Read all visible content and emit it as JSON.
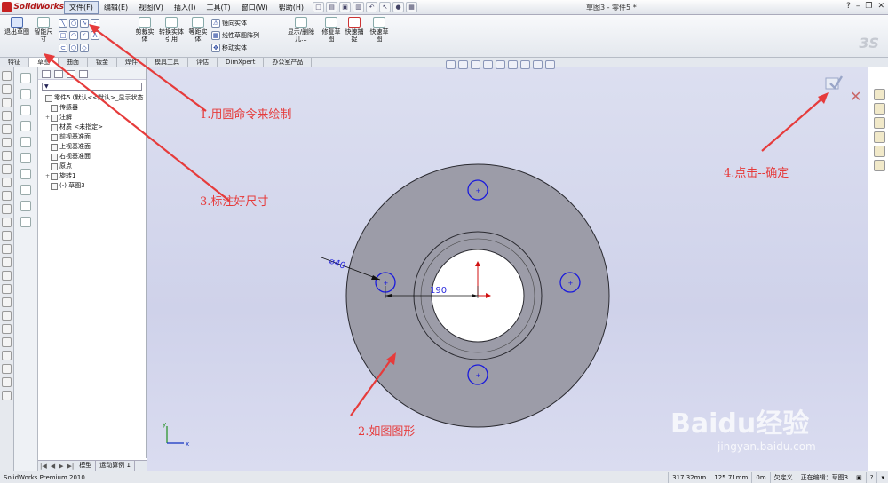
{
  "app": {
    "name": "SolidWorks",
    "doc_title": "草图3 - 零件5 *"
  },
  "menu": [
    "文件(F)",
    "编辑(E)",
    "视图(V)",
    "插入(I)",
    "工具(T)",
    "窗口(W)",
    "帮助(H)"
  ],
  "ribbon": {
    "exit_sketch": "退出草图",
    "smart_dim": "智能尺寸",
    "trim": "剪裁实体",
    "convert": "转换实体引用",
    "offset": "等距实体",
    "mirror": "镜向实体",
    "linear_pattern": "线性草图阵列",
    "move": "移动实体",
    "display_delete": "显示/删除几...",
    "repair": "修复草图",
    "quick_snap": "快速捕捉",
    "rapid_sketch": "快速草图"
  },
  "tabs": [
    "特征",
    "草图",
    "曲面",
    "钣金",
    "焊件",
    "模具工具",
    "评估",
    "DimXpert",
    "办公室产品"
  ],
  "tree": {
    "filter_icon": "filter-icon",
    "items": [
      {
        "label": "零件5  (默认<<默认>_显示状态",
        "indent": 0,
        "expand": ""
      },
      {
        "label": "传感器",
        "indent": 1,
        "expand": ""
      },
      {
        "label": "注解",
        "indent": 1,
        "expand": "+"
      },
      {
        "label": "材质 <未指定>",
        "indent": 1,
        "expand": ""
      },
      {
        "label": "前视基准面",
        "indent": 1,
        "expand": ""
      },
      {
        "label": "上视基准面",
        "indent": 1,
        "expand": ""
      },
      {
        "label": "右视基准面",
        "indent": 1,
        "expand": ""
      },
      {
        "label": "原点",
        "indent": 1,
        "expand": ""
      },
      {
        "label": "旋转1",
        "indent": 1,
        "expand": "+"
      },
      {
        "label": "(-) 草图3",
        "indent": 1,
        "expand": ""
      }
    ],
    "bottom_tabs": [
      "模型",
      "运动算例 1"
    ]
  },
  "dimensions": {
    "diameter": "⌀40",
    "distance": "190"
  },
  "status": {
    "product": "SolidWorks Premium 2010",
    "x": "317.32mm",
    "y": "125.71mm",
    "z": "0m",
    "state": "欠定义",
    "editing": "正在编辑：草图3"
  },
  "annotations": {
    "a1": "1.用圆命令来绘制",
    "a2": "2.如图图形",
    "a3": "3.标注好尺寸",
    "a4": "4.点击--确定"
  },
  "watermark": {
    "brand": "Baidu经验",
    "url": "jingyan.baidu.com"
  },
  "colors": {
    "part_fill": "#9c9ca8",
    "sketch_circle": "#1a1adc",
    "annotation": "#e63b3b",
    "origin": "#d01010"
  }
}
